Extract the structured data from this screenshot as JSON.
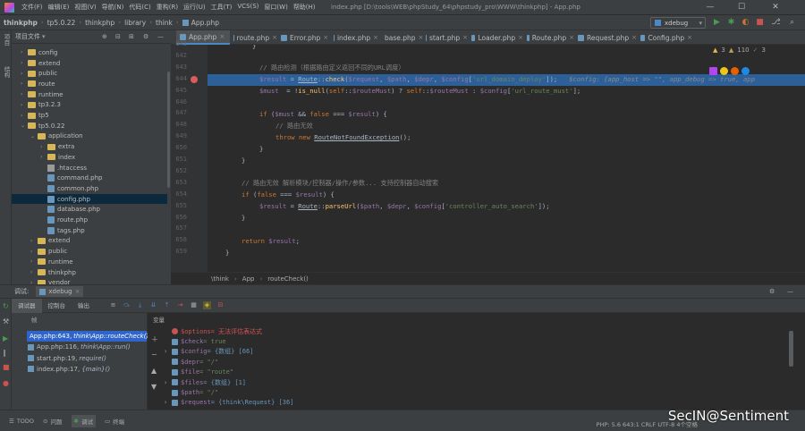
{
  "titlebar": {
    "menu": [
      "文件(F)",
      "编辑(E)",
      "视图(V)",
      "导航(N)",
      "代码(C)",
      "重构(R)",
      "运行(U)",
      "工具(T)",
      "VCS(S)",
      "窗口(W)",
      "帮助(H)"
    ],
    "window_title": "index.php [D:\\tools\\WEB\\phpStudy_64\\phpstudy_pro\\WWW\\thinkphp] - App.php",
    "minimize": "—",
    "maximize": "☐",
    "close": "✕"
  },
  "navbar": {
    "crumbs": [
      "thinkphp",
      "tp5.0.22",
      "thinkphp",
      "library",
      "think",
      "App.php"
    ],
    "run_config": "xdebug"
  },
  "project": {
    "header": "项目文件",
    "tree": [
      {
        "label": "config",
        "type": "folder",
        "depth": 1,
        "arrow": "›"
      },
      {
        "label": "extend",
        "type": "folder",
        "depth": 1,
        "arrow": "›"
      },
      {
        "label": "public",
        "type": "folder",
        "depth": 1,
        "arrow": "›"
      },
      {
        "label": "route",
        "type": "folder",
        "depth": 1,
        "arrow": "›"
      },
      {
        "label": "runtime",
        "type": "folder",
        "depth": 1,
        "arrow": "›"
      },
      {
        "label": "tp3.2.3",
        "type": "folder",
        "depth": 1,
        "arrow": "›"
      },
      {
        "label": "tp5",
        "type": "folder",
        "depth": 1,
        "arrow": "›"
      },
      {
        "label": "tp5.0.22",
        "type": "folder",
        "depth": 1,
        "arrow": "⌄"
      },
      {
        "label": "application",
        "type": "folder",
        "depth": 2,
        "arrow": "⌄"
      },
      {
        "label": "extra",
        "type": "folder",
        "depth": 3,
        "arrow": "›"
      },
      {
        "label": "index",
        "type": "folder",
        "depth": 3,
        "arrow": "›"
      },
      {
        "label": ".htaccess",
        "type": "ht",
        "depth": 3,
        "arrow": ""
      },
      {
        "label": "command.php",
        "type": "php",
        "depth": 3,
        "arrow": ""
      },
      {
        "label": "common.php",
        "type": "php",
        "depth": 3,
        "arrow": ""
      },
      {
        "label": "config.php",
        "type": "php",
        "depth": 3,
        "arrow": "",
        "selected": true
      },
      {
        "label": "database.php",
        "type": "php",
        "depth": 3,
        "arrow": ""
      },
      {
        "label": "route.php",
        "type": "php",
        "depth": 3,
        "arrow": ""
      },
      {
        "label": "tags.php",
        "type": "php",
        "depth": 3,
        "arrow": ""
      },
      {
        "label": "extend",
        "type": "folder",
        "depth": 2,
        "arrow": "›"
      },
      {
        "label": "public",
        "type": "folder",
        "depth": 2,
        "arrow": "›"
      },
      {
        "label": "runtime",
        "type": "folder",
        "depth": 2,
        "arrow": "›"
      },
      {
        "label": "thinkphp",
        "type": "folder",
        "depth": 2,
        "arrow": "›"
      },
      {
        "label": "vendor",
        "type": "folder",
        "depth": 2,
        "arrow": "›"
      }
    ]
  },
  "tabs": [
    {
      "label": "App.php",
      "active": true
    },
    {
      "label": "route.php"
    },
    {
      "label": "Error.php"
    },
    {
      "label": "index.php"
    },
    {
      "label": "base.php"
    },
    {
      "label": "start.php"
    },
    {
      "label": "Loader.php"
    },
    {
      "label": "Route.php"
    },
    {
      "label": "Request.php"
    },
    {
      "label": "Config.php"
    }
  ],
  "editor": {
    "analysis": {
      "warnings": "3",
      "weak": "110",
      "ok": "3"
    },
    "line_numbers": [
      "641",
      "642",
      "643",
      "644",
      "645",
      "646",
      "647",
      "648",
      "649",
      "650",
      "651",
      "652",
      "653",
      "654",
      "655",
      "656",
      "657",
      "658",
      "659"
    ],
    "breadcrumb": [
      "\\think",
      "App",
      "routeCheck()"
    ]
  },
  "debug": {
    "label": "调试:",
    "session": "xdebug",
    "subtabs": [
      "调试器",
      "控制台",
      "输出"
    ],
    "frames_label": "帧",
    "vars_label": "变量",
    "frames": [
      {
        "text": "App.php:643,",
        "detail": "think\\App::routeCheck()",
        "selected": true
      },
      {
        "text": "App.php:116,",
        "detail": "think\\App::run()"
      },
      {
        "text": "start.php:19,",
        "detail": "require()"
      },
      {
        "text": "index.php:17,",
        "detail": "{main}()"
      }
    ],
    "variables": [
      {
        "name": "$options",
        "value": "= 无法评估表达式",
        "kind": "error"
      },
      {
        "name": "$check",
        "value": "= true",
        "kind": "plain"
      },
      {
        "name": "$config",
        "value": "= {数组} [66]",
        "kind": "array"
      },
      {
        "name": "$depr",
        "value": "= \"/\"",
        "kind": "plain"
      },
      {
        "name": "$file",
        "value": "= \"route\"",
        "kind": "plain"
      },
      {
        "name": "$files",
        "value": "= {数组} [1]",
        "kind": "array"
      },
      {
        "name": "$path",
        "value": "= \"/\"",
        "kind": "plain"
      },
      {
        "name": "$request",
        "value": "= {think\\Request} [36]",
        "kind": "array"
      }
    ]
  },
  "statusbar": {
    "todo": "TODO",
    "problems": "问题",
    "debug": "调试",
    "terminal": "终端",
    "right": "PHP: 5.6    643:1    CRLF    UTF-8    4个空格",
    "watermark": "SecIN@Sentiment"
  }
}
